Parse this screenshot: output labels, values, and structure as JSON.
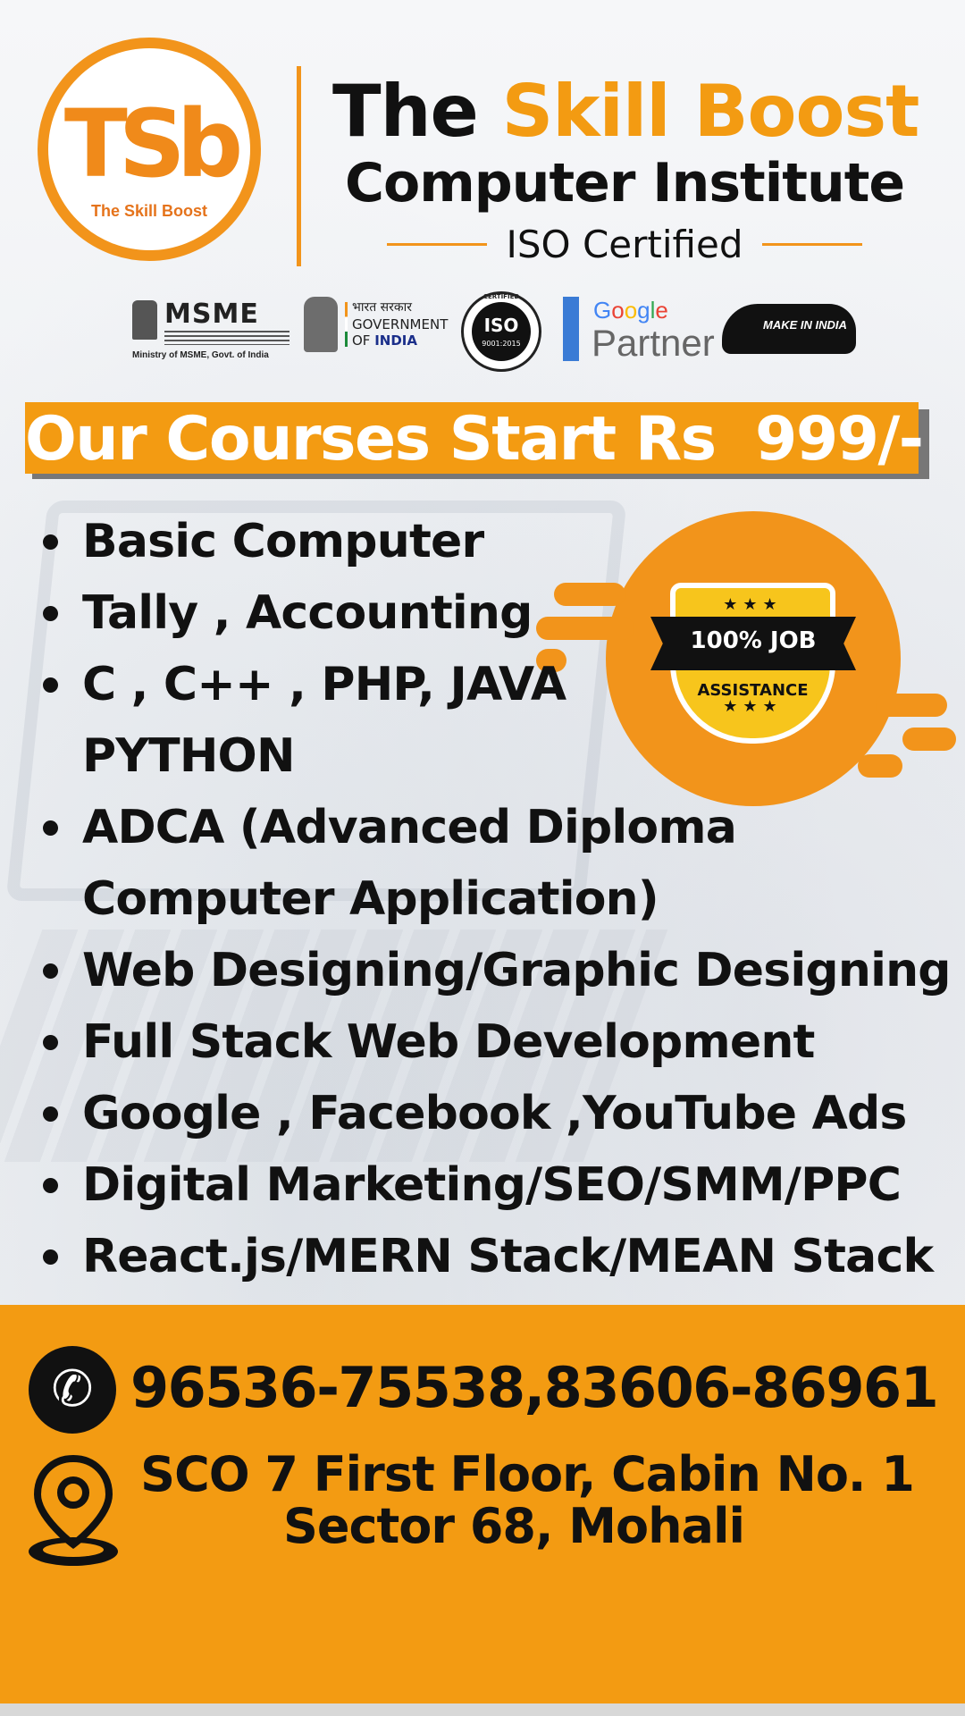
{
  "logo": {
    "letters": "TSb",
    "caption": "The Skill Boost"
  },
  "header": {
    "the": "The",
    "brand": "Skill Boost",
    "subtitle": "Computer Institute",
    "certification": "ISO Certified"
  },
  "partners": {
    "msme": {
      "word": "MSME",
      "caption": "Ministry of MSME, Govt. of India"
    },
    "gov": {
      "hindi": "भारत सरकार",
      "line1": "GOVERNMENT",
      "line2_prefix": "OF ",
      "line2_india": "INDIA"
    },
    "iso": {
      "ring": "CERTIFIED",
      "label": "ISO",
      "standard": "9001:2015"
    },
    "google": {
      "g1": "G",
      "g2": "o",
      "g3": "o",
      "g4": "g",
      "g5": "l",
      "g6": "e",
      "partner": "Partner"
    },
    "make_in_india": "MAKE IN INDIA"
  },
  "banner": {
    "text": "Our Courses Start Rs  999/-"
  },
  "courses": [
    {
      "line1": "Basic Computer",
      "line2": ""
    },
    {
      "line1": "Tally , Accounting",
      "line2": ""
    },
    {
      "line1": "C , C++ , PHP, JAVA",
      "line2": "PYTHON"
    },
    {
      "line1": "ADCA (Advanced Diploma",
      "line2": "Computer Application)"
    },
    {
      "line1": "Web Designing/Graphic Designing",
      "line2": ""
    },
    {
      "line1": "Full Stack Web Development",
      "line2": ""
    },
    {
      "line1": "Google , Facebook ,YouTube Ads",
      "line2": ""
    },
    {
      "line1": "Digital Marketing/SEO/SMM/PPC",
      "line2": ""
    },
    {
      "line1": "React.js/MERN Stack/MEAN Stack",
      "line2": ""
    }
  ],
  "job_badge": {
    "stars": "★★★",
    "title": "100% JOB",
    "subtitle": "ASSISTANCE"
  },
  "contact": {
    "phone": "96536-75538,83606-86961",
    "address_line1": "SCO 7 First Floor, Cabin No. 1",
    "address_line2": "Sector 68, Mohali"
  },
  "colors": {
    "accent": "#f39b12",
    "text": "#111111",
    "google_blue": "#4285f4"
  },
  "icons": {
    "phone": "phone-icon",
    "location": "location-pin-icon"
  }
}
